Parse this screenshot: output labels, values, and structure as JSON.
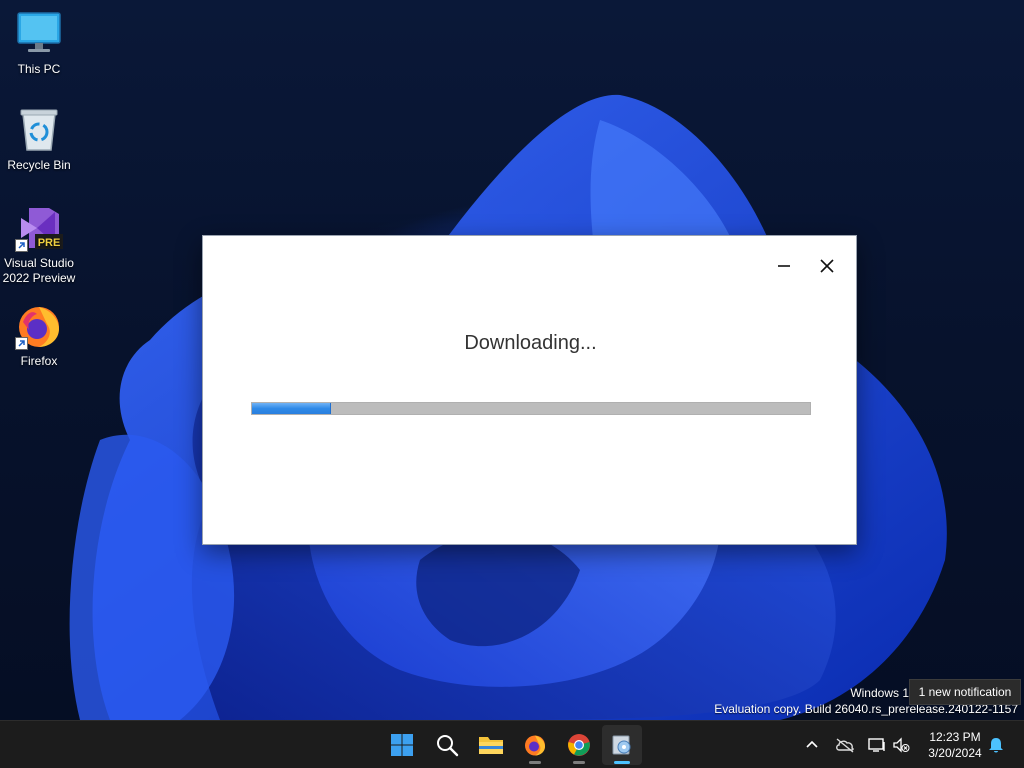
{
  "desktop": {
    "icons": [
      {
        "label": "This PC",
        "icon": "monitor-icon"
      },
      {
        "label": "Recycle Bin",
        "icon": "recycle-bin-icon"
      },
      {
        "label": "Visual Studio 2022 Preview",
        "icon": "visual-studio-preview-icon",
        "badge": "PRE"
      },
      {
        "label": "Firefox",
        "icon": "firefox-icon"
      }
    ],
    "watermark": {
      "line1": "Windows 1",
      "line2": "Evaluation copy. Build 26040.rs_prerelease.240122-1157"
    }
  },
  "dialog": {
    "title": "Downloading...",
    "progress": 0.14,
    "colors": {
      "fill": "#2f8ae8",
      "track": "#bcbcbc"
    }
  },
  "notification": {
    "text": "1 new notification"
  },
  "taskbar": {
    "apps": [
      {
        "name": "Start",
        "icon": "windows-start-icon"
      },
      {
        "name": "Search",
        "icon": "search-icon"
      },
      {
        "name": "File Explorer",
        "icon": "folder-icon"
      },
      {
        "name": "Firefox",
        "icon": "firefox-icon"
      },
      {
        "name": "Chrome",
        "icon": "chrome-icon"
      },
      {
        "name": "Installer",
        "icon": "installer-icon"
      }
    ],
    "tray": {
      "time": "12:23 PM",
      "date": "3/20/2024"
    }
  }
}
